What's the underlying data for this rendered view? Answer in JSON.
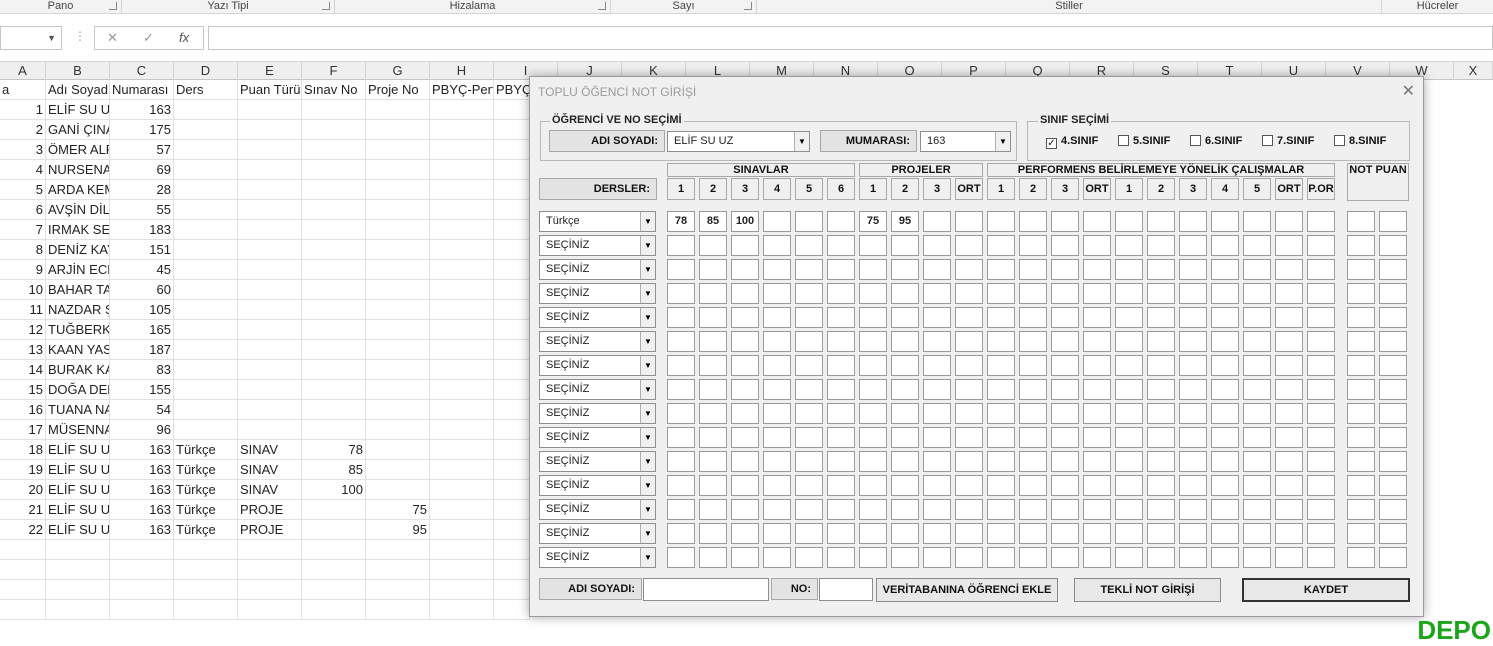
{
  "ribbon": {
    "groups": [
      "Pano",
      "Yazı Tipi",
      "Hizalama",
      "Sayı",
      "Stiller",
      "Hücreler"
    ]
  },
  "formula_bar": {
    "name_box": "",
    "cancel_icon": "✕",
    "enter_icon": "✓",
    "fx": "fx",
    "value": ""
  },
  "columns": [
    "A",
    "B",
    "C",
    "D",
    "E",
    "F",
    "G",
    "H",
    "I",
    "J",
    "K",
    "L",
    "M",
    "N",
    "O",
    "P",
    "Q",
    "R",
    "S",
    "T",
    "U",
    "V",
    "W",
    "X"
  ],
  "sheet": {
    "headers": [
      "a",
      "Adı Soyadı",
      "Numarası",
      "Ders",
      "Puan Türü",
      "Sınav No",
      "Proje No",
      "PBYÇ-Performans",
      "PBYÇ"
    ],
    "rows": [
      [
        "1",
        "ELİF SU UZ",
        "163",
        "",
        "",
        "",
        ""
      ],
      [
        "2",
        "GANİ ÇINAR",
        "175",
        "",
        "",
        "",
        ""
      ],
      [
        "3",
        "ÖMER ALP",
        "57",
        "",
        "",
        "",
        ""
      ],
      [
        "4",
        "NURSENA",
        "69",
        "",
        "",
        "",
        ""
      ],
      [
        "5",
        "ARDA KEM",
        "28",
        "",
        "",
        "",
        ""
      ],
      [
        "6",
        "AVŞİN DİL",
        "55",
        "",
        "",
        "",
        ""
      ],
      [
        "7",
        "IRMAK SEL",
        "183",
        "",
        "",
        "",
        ""
      ],
      [
        "8",
        "DENİZ KAY",
        "151",
        "",
        "",
        "",
        ""
      ],
      [
        "9",
        "ARJİN ECR",
        "45",
        "",
        "",
        "",
        ""
      ],
      [
        "10",
        "BAHAR TA",
        "60",
        "",
        "",
        "",
        ""
      ],
      [
        "11",
        "NAZDAR Ş",
        "105",
        "",
        "",
        "",
        ""
      ],
      [
        "12",
        "TUĞBERK",
        "165",
        "",
        "",
        "",
        ""
      ],
      [
        "13",
        "KAAN YAS",
        "187",
        "",
        "",
        "",
        ""
      ],
      [
        "14",
        "BURAK KA",
        "83",
        "",
        "",
        "",
        ""
      ],
      [
        "15",
        "DOĞA DEM",
        "155",
        "",
        "",
        "",
        ""
      ],
      [
        "16",
        "TUANA NA",
        "54",
        "",
        "",
        "",
        ""
      ],
      [
        "17",
        "MÜSENNA",
        "96",
        "",
        "",
        "",
        ""
      ],
      [
        "18",
        "ELİF SU UZ",
        "163",
        "Türkçe",
        "SINAV",
        "78",
        ""
      ],
      [
        "19",
        "ELİF SU UZ",
        "163",
        "Türkçe",
        "SINAV",
        "85",
        ""
      ],
      [
        "20",
        "ELİF SU UZ",
        "163",
        "Türkçe",
        "SINAV",
        "100",
        ""
      ],
      [
        "21",
        "ELİF SU UZ",
        "163",
        "Türkçe",
        "PROJE",
        "",
        "75"
      ],
      [
        "22",
        "ELİF SU UZ",
        "163",
        "Türkçe",
        "PROJE",
        "",
        "95"
      ]
    ]
  },
  "dialog": {
    "title": "TOPLU ÖĞENCİ NOT GİRİŞİ",
    "close": "✕",
    "student_group": "ÖĞRENCİ VE NO SEÇİMİ",
    "name_label": "ADI SOYADI:",
    "name_value": "ELİF SU UZ",
    "number_label": "MUMARASI:",
    "number_value": "163",
    "class_group": "SINIF SEÇİMİ",
    "classes": [
      {
        "label": "4.SINIF",
        "checked": true
      },
      {
        "label": "5.SINIF",
        "checked": false
      },
      {
        "label": "6.SINIF",
        "checked": false
      },
      {
        "label": "7.SINIF",
        "checked": false
      },
      {
        "label": "8.SINIF",
        "checked": false
      }
    ],
    "dersler_label": "DERSLER:",
    "group_headers": [
      "SINAVLAR",
      "PROJELER",
      "PERFORMENS BELİRLEMEYE YÖNELİK ÇALIŞMALAR",
      "NOT PUAN"
    ],
    "sub_headers": [
      "1",
      "2",
      "3",
      "4",
      "5",
      "6",
      "1",
      "2",
      "3",
      "ORT",
      "1",
      "2",
      "3",
      "ORT",
      "1",
      "2",
      "3",
      "4",
      "5",
      "ORT",
      "P.OR"
    ],
    "course_rows": [
      {
        "course": "Türkçe",
        "values": [
          "78",
          "85",
          "100",
          "",
          "",
          "",
          "75",
          "95"
        ]
      },
      {
        "course": "SEÇİNİZ",
        "values": []
      },
      {
        "course": "SEÇİNİZ",
        "values": []
      },
      {
        "course": "SEÇİNİZ",
        "values": []
      },
      {
        "course": "SEÇİNİZ",
        "values": []
      },
      {
        "course": "SEÇİNİZ",
        "values": []
      },
      {
        "course": "SEÇİNİZ",
        "values": []
      },
      {
        "course": "SEÇİNİZ",
        "values": []
      },
      {
        "course": "SEÇİNİZ",
        "values": []
      },
      {
        "course": "SEÇİNİZ",
        "values": []
      },
      {
        "course": "SEÇİNİZ",
        "values": []
      },
      {
        "course": "SEÇİNİZ",
        "values": []
      },
      {
        "course": "SEÇİNİZ",
        "values": []
      },
      {
        "course": "SEÇİNİZ",
        "values": []
      },
      {
        "course": "SEÇİNİZ",
        "values": []
      }
    ],
    "footer": {
      "name_label": "ADI SOYADI:",
      "no_label": "NO:",
      "add_button": "VERİTABANINA ÖĞRENCİ EKLE",
      "single_button": "TEKLİ NOT GİRİŞİ",
      "save_button": "KAYDET"
    }
  },
  "watermark": "DEPO"
}
